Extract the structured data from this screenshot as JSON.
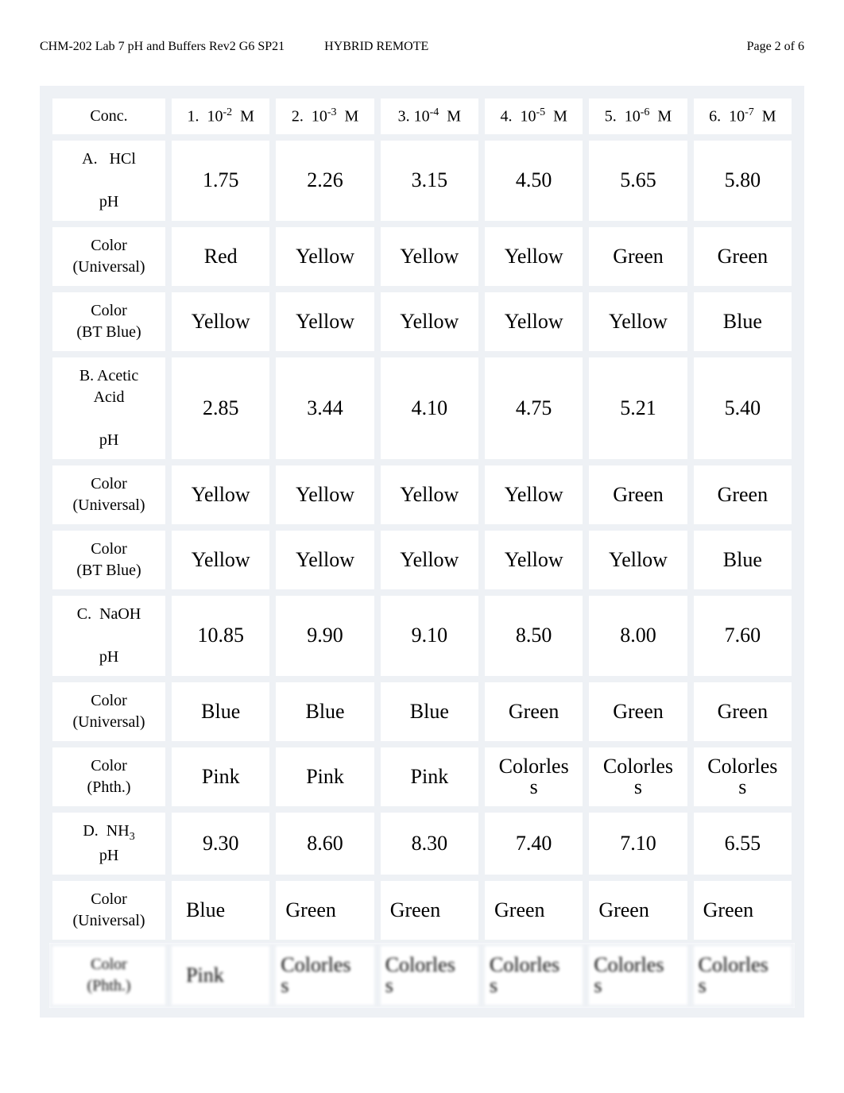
{
  "header": {
    "left": "CHM-202 Lab 7 pH and Buffers Rev2 G6 SP21",
    "mid": "HYBRID REMOTE",
    "right": "Page 2 of 6"
  },
  "chart_data": {
    "type": "table",
    "columns": [
      "Conc.",
      "1.  10-2  M",
      "2.  10-3  M",
      "3. 10-4  M",
      "4.  10-5  M",
      "5.  10-6  M",
      "6.  10-7  M"
    ],
    "rows": [
      {
        "label": "A.   HCl\n\npH",
        "cells": [
          "1.75",
          "2.26",
          "3.15",
          "4.50",
          "5.65",
          "5.80"
        ]
      },
      {
        "label": "Color\n(Universal)",
        "cells": [
          "Red",
          "Yellow",
          "Yellow",
          "Yellow",
          "Green",
          "Green"
        ]
      },
      {
        "label": "Color\n(BT Blue)",
        "cells": [
          "Yellow",
          "Yellow",
          "Yellow",
          "Yellow",
          "Yellow",
          "Blue"
        ]
      },
      {
        "label": "B. Acetic\nAcid\n\npH",
        "cells": [
          "2.85",
          "3.44",
          "4.10",
          "4.75",
          "5.21",
          "5.40"
        ]
      },
      {
        "label": "Color\n(Universal)",
        "cells": [
          "Yellow",
          "Yellow",
          "Yellow",
          "Yellow",
          "Green",
          "Green"
        ]
      },
      {
        "label": "Color\n(BT Blue)",
        "cells": [
          "Yellow",
          "Yellow",
          "Yellow",
          "Yellow",
          "Yellow",
          "Blue"
        ]
      },
      {
        "label": "C.  NaOH\n\npH",
        "cells": [
          "10.85",
          "9.90",
          "9.10",
          "8.50",
          "8.00",
          "7.60"
        ]
      },
      {
        "label": "Color\n(Universal)",
        "cells": [
          "Blue",
          "Blue",
          "Blue",
          "Green",
          "Green",
          "Green"
        ]
      },
      {
        "label": "Color\n(Phth.)",
        "cells": [
          "Pink",
          "Pink",
          "Pink",
          "Colorless",
          "Colorless",
          "Colorless"
        ]
      },
      {
        "label": "D.  NH3\npH",
        "cells": [
          "9.30",
          "8.60",
          "8.30",
          "7.40",
          "7.10",
          "6.55"
        ]
      },
      {
        "label": "Color\n(Universal)",
        "cells": [
          "Blue",
          "Green",
          "Green",
          "Green",
          "Green",
          "Green"
        ]
      },
      {
        "label": "Color\n(Phth.)",
        "cells": [
          "Pink",
          "Colorless",
          "Colorless",
          "Colorless",
          "Colorless",
          "Colorless"
        ]
      }
    ]
  }
}
